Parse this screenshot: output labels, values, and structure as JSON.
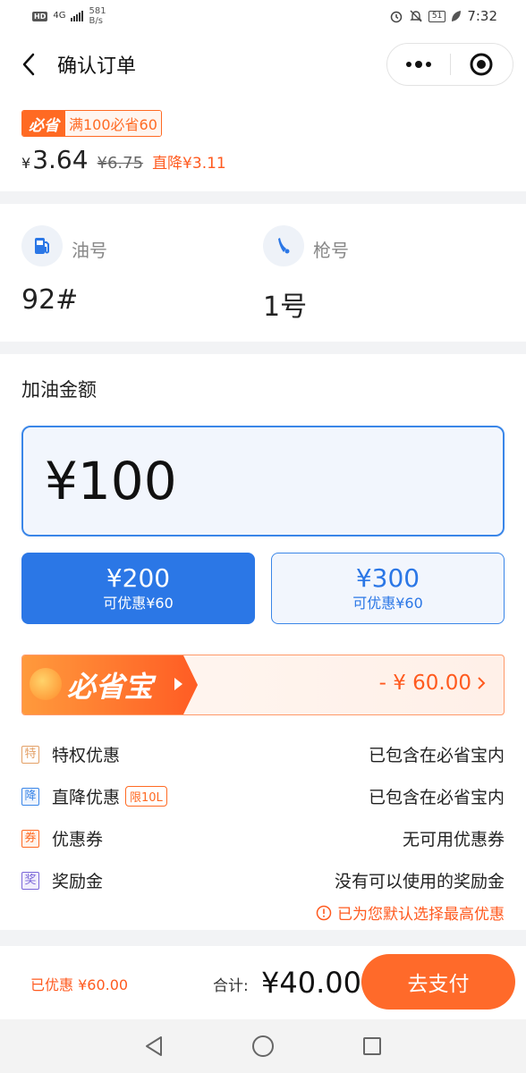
{
  "status_bar": {
    "network_type": "4G",
    "speed_value": "581",
    "speed_unit": "B/s",
    "battery": "51",
    "time": "7:32"
  },
  "header": {
    "title": "确认订单"
  },
  "price": {
    "promo_logo": "必省",
    "promo_text": "满100必省60",
    "currency": "¥",
    "current": "3.64",
    "original": "¥6.75",
    "cut": "直降¥3.11"
  },
  "oil": {
    "grade_label": "油号",
    "grade_value": "92#",
    "gun_label": "枪号",
    "gun_value": "1号"
  },
  "amount": {
    "title": "加油金额",
    "input_value": "¥100",
    "options": [
      {
        "amount": "¥200",
        "discount": "可优惠¥60",
        "selected": true
      },
      {
        "amount": "¥300",
        "discount": "可优惠¥60",
        "selected": false
      }
    ]
  },
  "bishengbao": {
    "name": "必省宝",
    "discount": "- ¥ 60.00"
  },
  "benefits": [
    {
      "tag": "特",
      "label": "特权优惠",
      "value": "已包含在必省宝内",
      "color": "#e3a066"
    },
    {
      "tag": "降",
      "label": "直降优惠",
      "badge": "限10L",
      "value": "已包含在必省宝内",
      "color": "#3a86e8"
    },
    {
      "tag": "券",
      "label": "优惠券",
      "value": "无可用优惠券",
      "color": "#ff6a23"
    },
    {
      "tag": "奖",
      "label": "奖励金",
      "value": "没有可以使用的奖励金",
      "color": "#7a66d8"
    }
  ],
  "note": "已为您默认选择最高优惠",
  "footer": {
    "saved": "已优惠 ¥60.00",
    "total_label": "合计:",
    "total": "¥40.00",
    "pay_button": "去支付"
  },
  "colors": {
    "accent_blue": "#2b77e6",
    "accent_orange": "#ff6a2a"
  }
}
